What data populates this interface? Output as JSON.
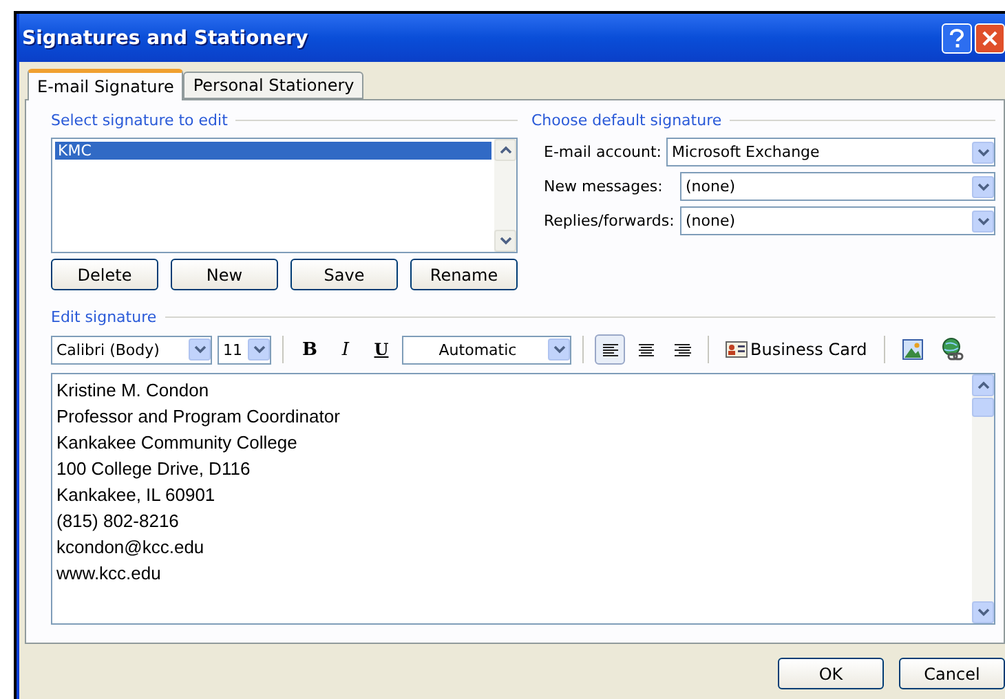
{
  "window": {
    "title": "Signatures and Stationery"
  },
  "tabs": [
    {
      "label": "E-mail Signature",
      "selected": true
    },
    {
      "label": "Personal Stationery",
      "selected": false
    }
  ],
  "select_section": {
    "heading": "Select signature to edit",
    "signatures": [
      {
        "name": "KMC",
        "selected": true
      }
    ],
    "buttons": [
      "Delete",
      "New",
      "Save",
      "Rename"
    ]
  },
  "default_section": {
    "heading": "Choose default signature",
    "fields": [
      {
        "label": "E-mail account:",
        "value": "Microsoft Exchange"
      },
      {
        "label": "New messages:",
        "value": "(none)"
      },
      {
        "label": "Replies/forwards:",
        "value": "(none)"
      }
    ]
  },
  "edit_section": {
    "heading": "Edit signature",
    "font": "Calibri (Body)",
    "size": "11",
    "format_buttons": [
      {
        "kind": "bold",
        "label": "B"
      },
      {
        "kind": "italic",
        "label": "I"
      },
      {
        "kind": "underline",
        "label": "U"
      }
    ],
    "font_color": "Automatic",
    "align_buttons": [
      {
        "kind": "left",
        "selected": true
      },
      {
        "kind": "center",
        "selected": false
      },
      {
        "kind": "right",
        "selected": false
      }
    ],
    "business_card": "Business Card",
    "lines": [
      "Kristine M. Condon",
      "Professor and Program Coordinator",
      "Kankakee Community College",
      "100 College Drive, D116",
      "Kankakee, IL 60901",
      "(815) 802-8216",
      "kcondon@kcc.edu",
      "www.kcc.edu"
    ]
  },
  "buttons": [
    "OK",
    "Cancel"
  ]
}
